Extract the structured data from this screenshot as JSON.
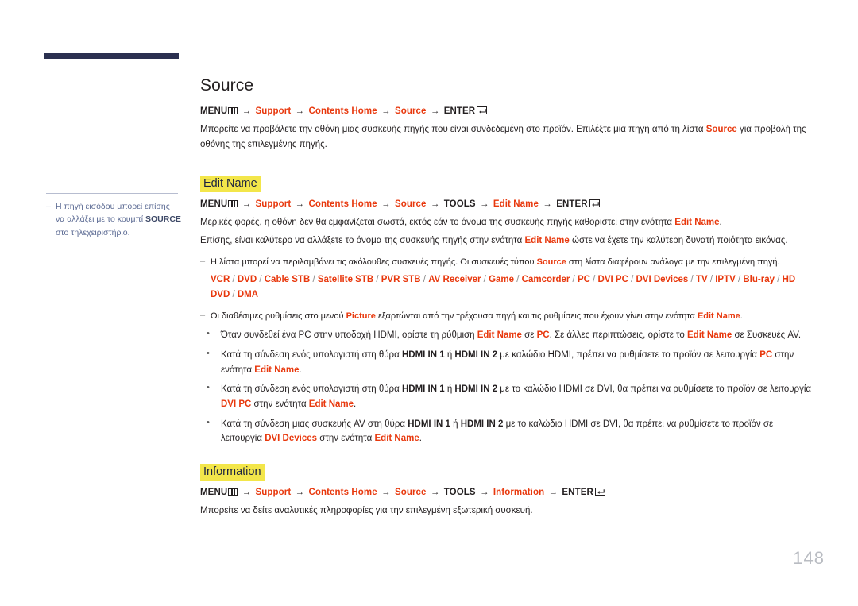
{
  "page": {
    "number": "148",
    "title": "Source"
  },
  "sidebar": {
    "note": {
      "dash": "–",
      "text_before": "Η πηγή εισόδου μπορεί επίσης να αλλάξει με το κουμπί ",
      "bold": "SOURCE",
      "text_after": " στο τηλεχειριστήριο."
    }
  },
  "source_section": {
    "path": {
      "menu": "MENU",
      "arrow": "→",
      "step1": "Support",
      "step2": "Contents Home",
      "step3": "Source",
      "enter": "ENTER"
    },
    "paragraph_before": "Μπορείτε να προβάλετε την οθόνη μιας συσκευής πηγής που είναι συνδεδεμένη στο προϊόν. Επιλέξτε μια πηγή από τη λίστα ",
    "paragraph_highlight": "Source",
    "paragraph_after": " για προβολή της οθόνης της επιλεγμένης πηγής."
  },
  "edit_name_section": {
    "heading": "Edit Name",
    "path": {
      "menu": "MENU",
      "arrow": "→",
      "step1": "Support",
      "step2": "Contents Home",
      "step3": "Source",
      "step4": "TOOLS",
      "step5": "Edit Name",
      "enter": "ENTER"
    },
    "para1_a": "Μερικές φορές, η οθόνη δεν θα εμφανίζεται σωστά, εκτός εάν το όνομα της συσκευής πηγής καθοριστεί στην ενότητα ",
    "para1_hl": "Edit Name",
    "para1_b": ".",
    "para2_a": "Επίσης, είναι καλύτερο να αλλάξετε το όνομα της συσκευής πηγής στην ενότητα ",
    "para2_hl": "Edit Name",
    "para2_b": " ώστε να έχετε την καλύτερη δυνατή ποιότητα εικόνας.",
    "note1": {
      "dash": "–",
      "a": "Η λίστα μπορεί να περιλαμβάνει τις ακόλουθες συσκευές πηγής. Οι συσκευές τύπου ",
      "hl": "Source",
      "b": " στη λίστα διαφέρουν ανάλογα με την επιλεγμένη πηγή.",
      "devices": [
        "VCR",
        "DVD",
        "Cable STB",
        "Satellite STB",
        "PVR STB",
        "AV Receiver",
        "Game",
        "Camcorder",
        "PC",
        "DVI PC",
        "DVI Devices",
        "TV",
        "IPTV",
        "Blu-ray",
        "HD DVD",
        "DMA"
      ],
      "separator": "/"
    },
    "note2": {
      "dash": "–",
      "a": "Οι διαθέσιμες ρυθμίσεις στο μενού ",
      "hl1": "Picture",
      "b": " εξαρτώνται από την τρέχουσα πηγή και τις ρυθμίσεις που έχουν γίνει στην ενότητα ",
      "hl2": "Edit Name",
      "c": "."
    },
    "bullets": [
      {
        "parts": [
          {
            "t": "Όταν συνδεθεί ένα PC στην υποδοχή HDMI, ορίστε τη ρύθμιση ",
            "s": "n"
          },
          {
            "t": "Edit Name",
            "s": "r"
          },
          {
            "t": " σε ",
            "s": "n"
          },
          {
            "t": "PC",
            "s": "r"
          },
          {
            "t": ". Σε άλλες περιπτώσεις, ορίστε το ",
            "s": "n"
          },
          {
            "t": "Edit Name",
            "s": "r"
          },
          {
            "t": " σε Συσκευές AV.",
            "s": "n"
          }
        ]
      },
      {
        "parts": [
          {
            "t": "Κατά τη σύνδεση ενός υπολογιστή στη θύρα ",
            "s": "n"
          },
          {
            "t": "HDMI IN 1",
            "s": "b"
          },
          {
            "t": " ή ",
            "s": "n"
          },
          {
            "t": "HDMI IN 2",
            "s": "b"
          },
          {
            "t": " με καλώδιο HDMI, πρέπει να ρυθμίσετε το προϊόν σε λειτουργία ",
            "s": "n"
          },
          {
            "t": "PC",
            "s": "r"
          },
          {
            "t": " στην ενότητα ",
            "s": "n"
          },
          {
            "t": "Edit Name",
            "s": "r"
          },
          {
            "t": ".",
            "s": "n"
          }
        ]
      },
      {
        "parts": [
          {
            "t": "Κατά τη σύνδεση ενός υπολογιστή στη θύρα ",
            "s": "n"
          },
          {
            "t": "HDMI IN 1",
            "s": "b"
          },
          {
            "t": " ή ",
            "s": "n"
          },
          {
            "t": "HDMI IN 2",
            "s": "b"
          },
          {
            "t": " με το καλώδιο HDMI σε DVI, θα πρέπει να ρυθμίσετε το προϊόν σε λειτουργία ",
            "s": "n"
          },
          {
            "t": "DVI PC",
            "s": "r"
          },
          {
            "t": " στην ενότητα ",
            "s": "n"
          },
          {
            "t": "Edit Name",
            "s": "r"
          },
          {
            "t": ".",
            "s": "n"
          }
        ]
      },
      {
        "parts": [
          {
            "t": "Κατά τη σύνδεση μιας συσκευής AV στη θύρα ",
            "s": "n"
          },
          {
            "t": "HDMI IN 1",
            "s": "b"
          },
          {
            "t": " ή ",
            "s": "n"
          },
          {
            "t": "HDMI IN 2",
            "s": "b"
          },
          {
            "t": " με το καλώδιο HDMI σε DVI, θα πρέπει να ρυθμίσετε το προϊόν σε λειτουργία ",
            "s": "n"
          },
          {
            "t": "DVI Devices",
            "s": "r"
          },
          {
            "t": " στην ενότητα ",
            "s": "n"
          },
          {
            "t": "Edit Name",
            "s": "r"
          },
          {
            "t": ".",
            "s": "n"
          }
        ]
      }
    ]
  },
  "information_section": {
    "heading": "Information",
    "path": {
      "menu": "MENU",
      "arrow": "→",
      "step1": "Support",
      "step2": "Contents Home",
      "step3": "Source",
      "step4": "TOOLS",
      "step5": "Information",
      "enter": "ENTER"
    },
    "paragraph": "Μπορείτε να δείτε αναλυτικές πληροφορίες για την επιλεγμένη εξωτερική συσκευή."
  },
  "colors": {
    "accent_red": "#e8380d",
    "highlight_yellow": "#f3e64a",
    "navy_bar": "#2b3050",
    "side_note": "#5b6a93",
    "page_number": "#b9bcc2"
  }
}
